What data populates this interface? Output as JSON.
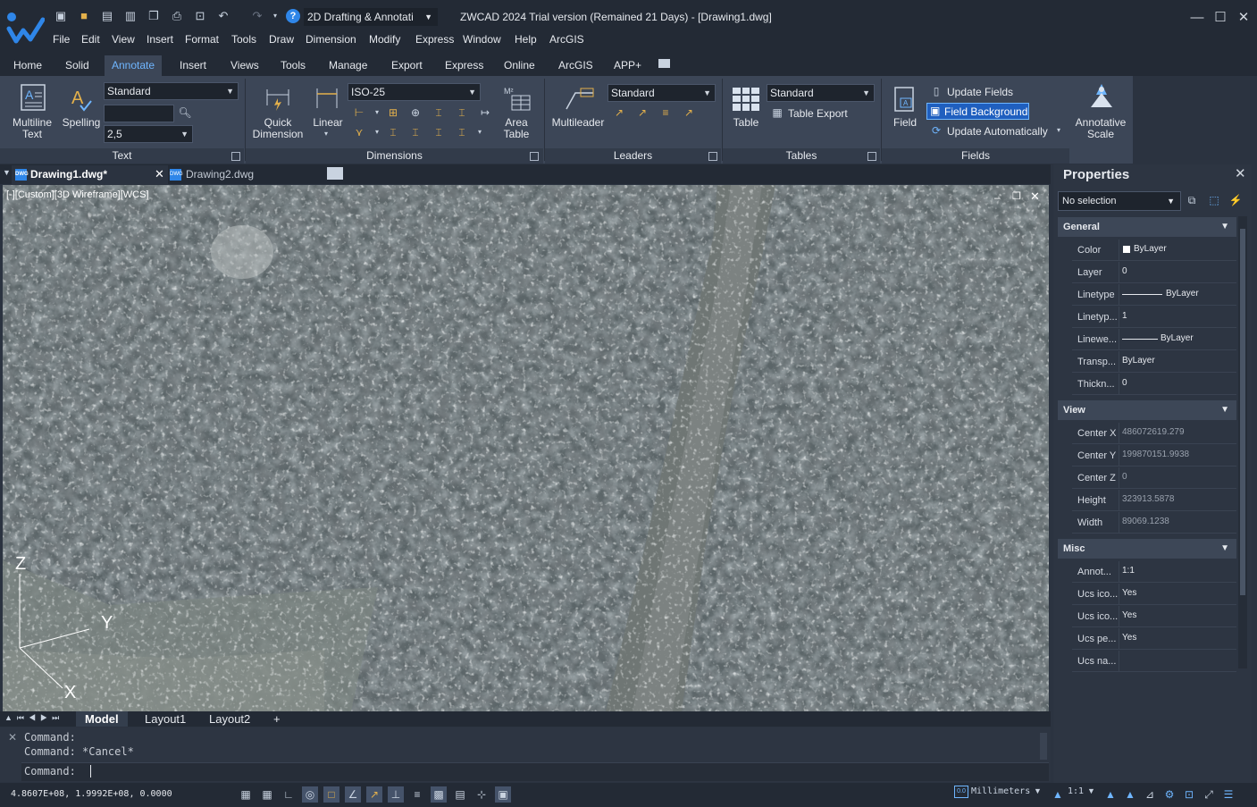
{
  "titlebar": {
    "workspace": "2D Drafting & Annotati",
    "title": "ZWCAD 2024 Trial version (Remained 21 Days) - [Drawing1.dwg]"
  },
  "menu": [
    "File",
    "Edit",
    "View",
    "Insert",
    "Format",
    "Tools",
    "Draw",
    "Dimension",
    "Modify",
    "Express",
    "Window",
    "Help",
    "ArcGIS"
  ],
  "ribbon_tabs": [
    "Home",
    "Solid",
    "Annotate",
    "Insert",
    "Views",
    "Tools",
    "Manage",
    "Export",
    "Express",
    "Online",
    "ArcGIS",
    "APP+"
  ],
  "active_ribbon_tab": "Annotate",
  "ribbon": {
    "text": {
      "multiline_text": "Multiline Text",
      "spelling": "Spelling",
      "style": "Standard",
      "height": "2,5",
      "panel": "Text"
    },
    "dimensions": {
      "quick_dimension": "Quick Dimension",
      "linear": "Linear",
      "style": "ISO-25",
      "area_table": "Area Table",
      "panel": "Dimensions"
    },
    "leaders": {
      "multileader": "Multileader",
      "style": "Standard",
      "panel": "Leaders"
    },
    "tables": {
      "table": "Table",
      "style": "Standard",
      "table_export": "Table Export",
      "panel": "Tables"
    },
    "fields": {
      "field": "Field",
      "update_fields": "Update Fields",
      "field_background": "Field Background",
      "update_automatically": "Update Automatically",
      "panel": "Fields"
    },
    "annotative_scale": "Annotative Scale"
  },
  "doc_tabs": [
    "Drawing1.dwg*",
    "Drawing2.dwg"
  ],
  "viewport": {
    "label": "[-][Custom][3D Wireframe][WCS]",
    "axis_z": "Z",
    "axis_y": "Y",
    "axis_x": "X"
  },
  "layout_tabs": [
    "Model",
    "Layout1",
    "Layout2",
    "+"
  ],
  "command": {
    "lines": [
      "Command:",
      "Command: *Cancel*"
    ],
    "prompt": "Command:"
  },
  "statusbar": {
    "coords": "4.8607E+08, 1.9992E+08, 0.0000",
    "units": "Millimeters",
    "scale": "1:1"
  },
  "properties": {
    "title": "Properties",
    "selection": "No selection",
    "sections": [
      {
        "name": "General",
        "rows": [
          {
            "name": "Color",
            "value": "ByLayer"
          },
          {
            "name": "Layer",
            "value": "0"
          },
          {
            "name": "Linetype",
            "value": "ByLayer"
          },
          {
            "name": "Linetyp...",
            "value": "1"
          },
          {
            "name": "Linewe...",
            "value": "ByLayer"
          },
          {
            "name": "Transp...",
            "value": "ByLayer"
          },
          {
            "name": "Thickn...",
            "value": "0"
          }
        ]
      },
      {
        "name": "View",
        "rows": [
          {
            "name": "Center X",
            "value": "486072619.279"
          },
          {
            "name": "Center Y",
            "value": "199870151.9938"
          },
          {
            "name": "Center Z",
            "value": "0"
          },
          {
            "name": "Height",
            "value": "323913.5878"
          },
          {
            "name": "Width",
            "value": "89069.1238"
          }
        ]
      },
      {
        "name": "Misc",
        "rows": [
          {
            "name": "Annot...",
            "value": "1:1"
          },
          {
            "name": "Ucs ico...",
            "value": "Yes"
          },
          {
            "name": "Ucs ico...",
            "value": "Yes"
          },
          {
            "name": "Ucs pe...",
            "value": "Yes"
          },
          {
            "name": "Ucs na...",
            "value": ""
          }
        ]
      }
    ]
  },
  "colors": {
    "accent": "#6fb6ff",
    "highlight": "#1f5fbf",
    "background": "#2b3340"
  }
}
